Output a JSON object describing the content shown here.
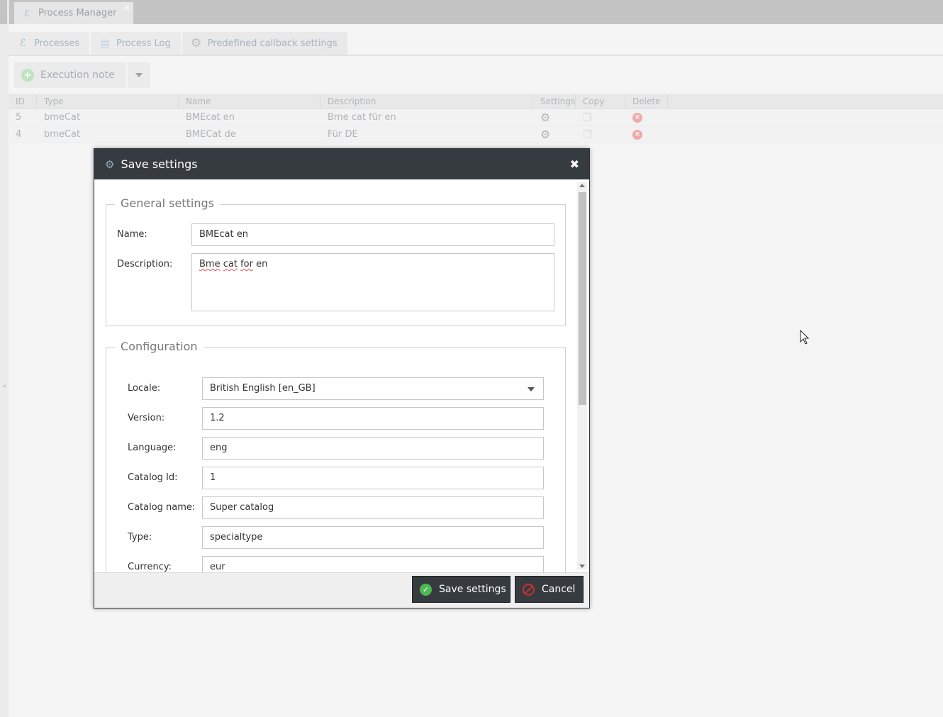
{
  "window_tab": {
    "title": "Process Manager",
    "close": "×"
  },
  "sub_tabs": [
    {
      "label": "Processes",
      "icon": "process-icon"
    },
    {
      "label": "Process Log",
      "icon": "log-icon"
    },
    {
      "label": "Predefined callback settings",
      "icon": "gear-icon"
    }
  ],
  "toolbar": {
    "execution_note_label": "Execution note"
  },
  "grid": {
    "columns": [
      "ID",
      "Type",
      "Name",
      "Description",
      "Settings",
      "Copy",
      "Delete"
    ],
    "rows": [
      {
        "id": "5",
        "type": "bmeCat",
        "name": "BMEcat en",
        "description": "Bme cat für en"
      },
      {
        "id": "4",
        "type": "bmeCat",
        "name": "BMECat de",
        "description": "Für DE"
      }
    ]
  },
  "dialog": {
    "title": "Save settings",
    "close": "✖",
    "general": {
      "legend": "General settings",
      "name_label": "Name:",
      "name_value": "BMEcat en",
      "description_label": "Description:",
      "description_value_words": [
        "Bme",
        "cat",
        "for",
        "en"
      ]
    },
    "config": {
      "legend": "Configuration",
      "fields": [
        {
          "label": "Locale:",
          "value": "British English [en_GB]",
          "kind": "select"
        },
        {
          "label": "Version:",
          "value": "1.2"
        },
        {
          "label": "Language:",
          "value": "eng"
        },
        {
          "label": "Catalog Id:",
          "value": "1"
        },
        {
          "label": "Catalog name:",
          "value": "Super catalog"
        },
        {
          "label": "Type:",
          "value": "specialtype"
        },
        {
          "label": "Currency:",
          "value": "eur"
        }
      ]
    },
    "footer": {
      "save_label": "Save settings",
      "cancel_label": "Cancel"
    }
  },
  "colors": {
    "dialog_header": "#363b40",
    "accent_green": "#4cb850",
    "danger_red": "#c83030"
  }
}
